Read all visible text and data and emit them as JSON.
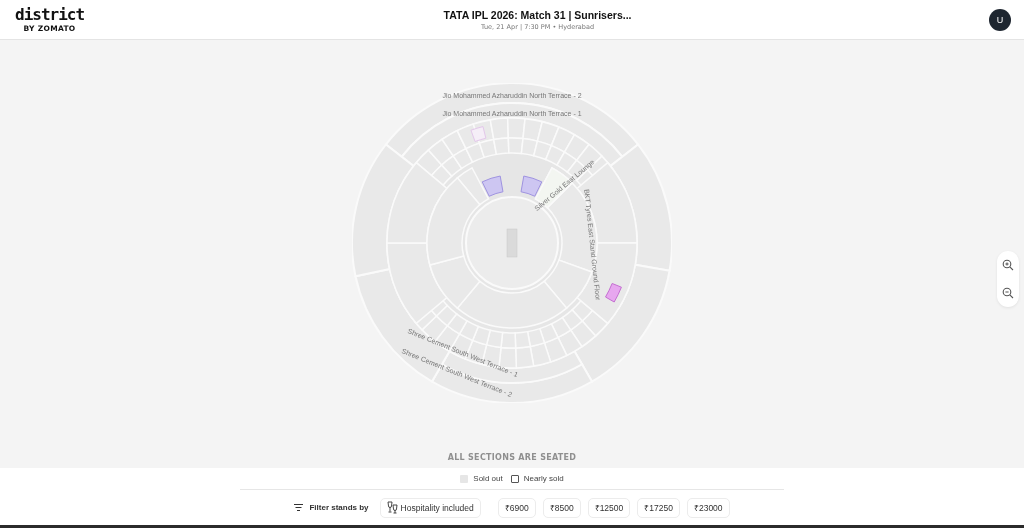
{
  "header": {
    "logo": "district",
    "logo_sub": "BY ZOMATO",
    "title": "TATA IPL 2026: Match 31 | Sunrisers...",
    "subtitle": "Tue, 21 Apr | 7:30 PM • Hyderabad",
    "avatar": "U"
  },
  "map": {
    "labels": [
      "Jio Mohammed Azharuddin North Terrace - 2",
      "Jio Mohammed Azharuddin North Terrace - 1",
      "Silver Gold East Lounge",
      "BKT Tyres East Stand Ground Floor",
      "Shree Cement South West Terrace - 1",
      "Shree Cement South West Terrace - 2"
    ],
    "note": "ALL SECTIONS ARE SEATED"
  },
  "legend": [
    {
      "label": "Sold out",
      "kind": "filled"
    },
    {
      "label": "Nearly sold",
      "kind": "outline"
    }
  ],
  "filter": {
    "label": "Filter stands by",
    "chips": [
      {
        "label": "Hospitality included",
        "kind": "hospitality",
        "selected": false
      },
      {
        "label": "₹6900",
        "kind": "price",
        "selected": false
      },
      {
        "label": "₹8500",
        "kind": "price",
        "selected": false
      },
      {
        "label": "₹12500",
        "kind": "price",
        "selected": false
      },
      {
        "label": "₹17250",
        "kind": "price",
        "selected": false
      },
      {
        "label": "₹23000",
        "kind": "price",
        "selected": false
      }
    ]
  }
}
